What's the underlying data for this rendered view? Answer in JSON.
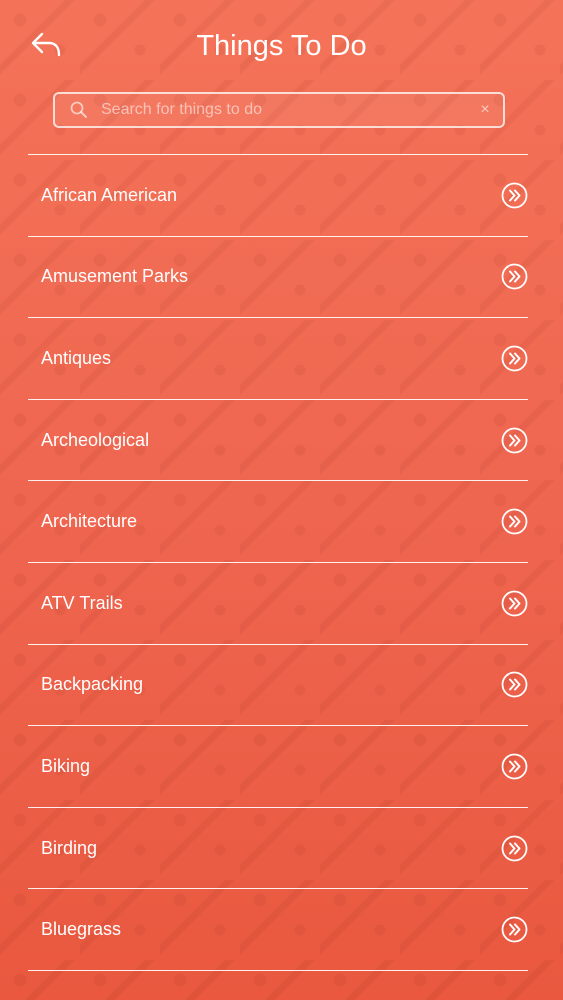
{
  "header": {
    "title": "Things To Do",
    "back_icon": "back-arrow-icon"
  },
  "search": {
    "placeholder": "Search for things to do",
    "value": "",
    "clear_label": "×"
  },
  "categories": [
    {
      "label": "African American"
    },
    {
      "label": "Amusement Parks"
    },
    {
      "label": "Antiques"
    },
    {
      "label": "Archeological"
    },
    {
      "label": "Architecture"
    },
    {
      "label": "ATV Trails"
    },
    {
      "label": "Backpacking"
    },
    {
      "label": "Biking"
    },
    {
      "label": "Birding"
    },
    {
      "label": "Bluegrass"
    }
  ],
  "colors": {
    "background_top": "#f47358",
    "background_bottom": "#e9583f",
    "foreground": "#ffffff"
  }
}
